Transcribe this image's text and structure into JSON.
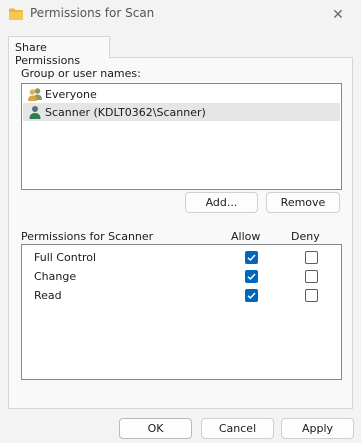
{
  "window": {
    "title": "Permissions for Scan",
    "close_glyph": "✕",
    "folder_icon_color": "#e8b43f"
  },
  "tabs": [
    {
      "label": "Share Permissions",
      "active": true
    }
  ],
  "group_section": {
    "label": "Group or user names:",
    "users": [
      {
        "name": "Everyone",
        "icon": "users-group-icon",
        "selected": false
      },
      {
        "name": "Scanner (KDLT0362\\Scanner)",
        "icon": "user-icon",
        "selected": true
      }
    ],
    "add_label": "Add...",
    "remove_label": "Remove"
  },
  "permissions": {
    "header": "Permissions for Scanner",
    "allow_label": "Allow",
    "deny_label": "Deny",
    "rows": [
      {
        "name": "Full Control",
        "allow": true,
        "deny": false
      },
      {
        "name": "Change",
        "allow": true,
        "deny": false
      },
      {
        "name": "Read",
        "allow": true,
        "deny": false
      }
    ]
  },
  "footer": {
    "ok_label": "OK",
    "cancel_label": "Cancel",
    "apply_label": "Apply"
  },
  "colors": {
    "accent": "#0067c0",
    "selected_row": "#e5e5e5"
  }
}
